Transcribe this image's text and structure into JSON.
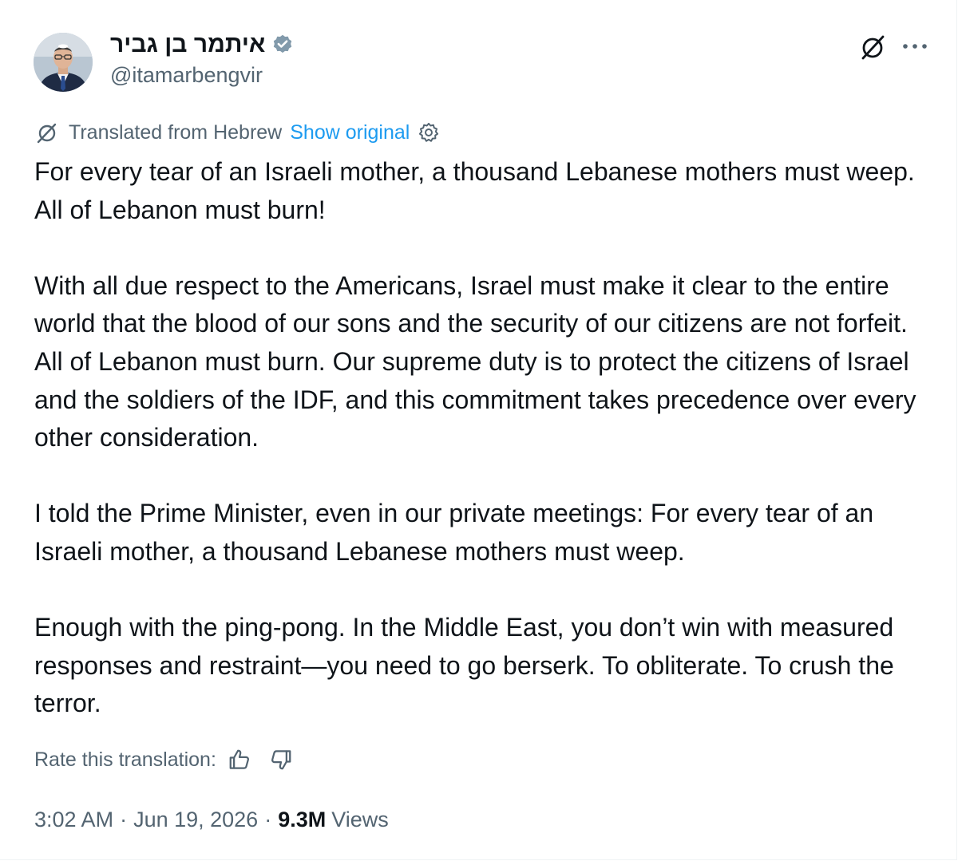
{
  "author": {
    "display_name": "איתמר בן גביר",
    "handle": "@itamarbengvir",
    "verified": true
  },
  "header_icons": {
    "grok": "grok-icon",
    "more": "more-icon"
  },
  "translation": {
    "label": "Translated from Hebrew",
    "show_original": "Show original",
    "icon": "translate-icon",
    "settings_icon": "settings-icon"
  },
  "tweet": {
    "paragraphs": [
      "For every tear of an Israeli mother, a thousand Lebanese mothers must weep. All of Lebanon must burn!",
      "With all due respect to the Americans, Israel must make it clear to the entire world that the blood of our sons and the security of our citizens are not forfeit. All of Lebanon must burn. Our supreme duty is to protect the citizens of Israel and the soldiers of the IDF, and this commitment takes precedence over every other consideration.",
      "I told the Prime Minister, even in our private meetings: For every tear of an Israeli mother, a thousand Lebanese mothers must weep.",
      "Enough with the ping-pong. In the Middle East, you don’t win with measured responses and restraint—you need to go berserk. To obliterate. To crush the terror."
    ]
  },
  "rate": {
    "label": "Rate this translation:",
    "up_icon": "thumb-up-icon",
    "down_icon": "thumb-down-icon"
  },
  "meta": {
    "time": "3:02 AM",
    "separator": "·",
    "date": "Jun 19, 2026",
    "views_count": "9.3M",
    "views_label": "Views"
  },
  "colors": {
    "text": "#0f1419",
    "secondary": "#536471",
    "link": "#1d9bf0",
    "verified_badge": "#829aab"
  }
}
